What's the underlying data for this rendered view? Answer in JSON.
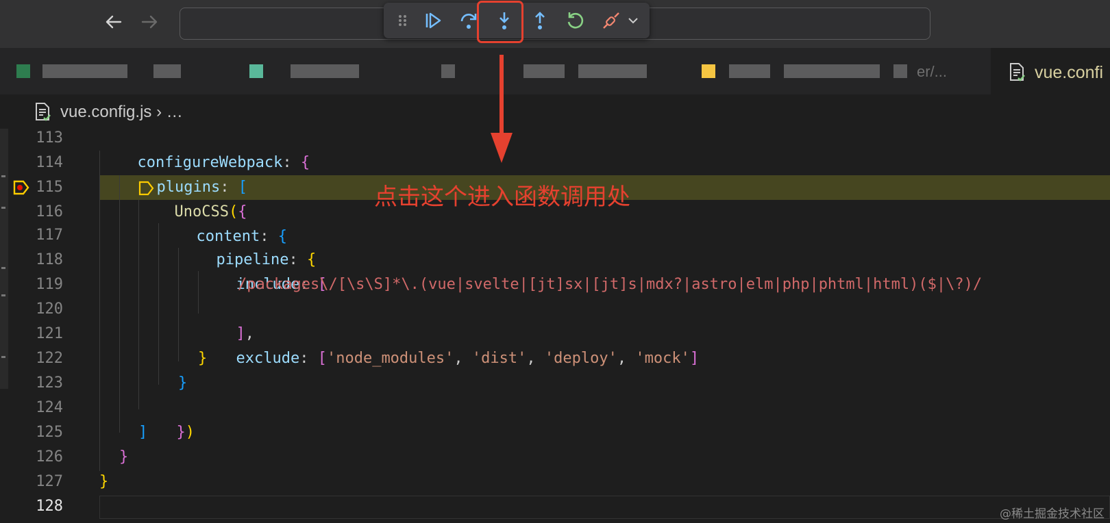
{
  "breadcrumb": {
    "file": "vue.config.js",
    "separator": "›",
    "more": "…"
  },
  "tabs": {
    "partial_text": "er/...",
    "active_label": "vue.confi"
  },
  "debug_toolbar": {
    "icons": [
      "drag-handle-icon",
      "continue-icon",
      "step-over-icon",
      "step-into-icon",
      "step-out-icon",
      "restart-icon",
      "disconnect-icon",
      "chevron-down-icon"
    ]
  },
  "annotation": {
    "text": "点击这个进入函数调用处"
  },
  "watermark": "@稀土掘金技术社区",
  "editor": {
    "lines": [
      {
        "n": "113",
        "active": false
      },
      {
        "n": "114",
        "active": false
      },
      {
        "n": "115",
        "active": false
      },
      {
        "n": "116",
        "active": false
      },
      {
        "n": "117",
        "active": false
      },
      {
        "n": "118",
        "active": false
      },
      {
        "n": "119",
        "active": false
      },
      {
        "n": "120",
        "active": false
      },
      {
        "n": "121",
        "active": false
      },
      {
        "n": "122",
        "active": false
      },
      {
        "n": "123",
        "active": false
      },
      {
        "n": "124",
        "active": false
      },
      {
        "n": "125",
        "active": false
      },
      {
        "n": "126",
        "active": false
      },
      {
        "n": "127",
        "active": false
      },
      {
        "n": "128",
        "active": true
      }
    ],
    "code": {
      "l113": [
        "configureWebpack",
        ": ",
        "{"
      ],
      "l114": [
        "plugins",
        ": ",
        "["
      ],
      "l115": [
        "UnoCSS",
        "(",
        "{"
      ],
      "l116": [
        "content",
        ": ",
        "{"
      ],
      "l117": [
        "pipeline",
        ": ",
        "{"
      ],
      "l118": [
        "include",
        ": ",
        "["
      ],
      "l119": "/packages\\/[\\s\\S]*\\.(vue|svelte|[jt]sx|[jt]s|mdx?|astro|elm|php|phtml|html)($|\\?)/",
      "l120": [
        "]",
        ","
      ],
      "l121": [
        "exclude",
        ": ",
        "[",
        "'node_modules'",
        ", ",
        "'dist'",
        ", ",
        "'deploy'",
        ", ",
        "'mock'",
        "]"
      ],
      "l122": "}",
      "l123": "}",
      "l124": [
        "}",
        ")"
      ],
      "l125": "]",
      "l126": "}",
      "l127": "}"
    }
  },
  "colors": {
    "annotation": "#e5412f",
    "line_highlight": "#4a4a20"
  }
}
